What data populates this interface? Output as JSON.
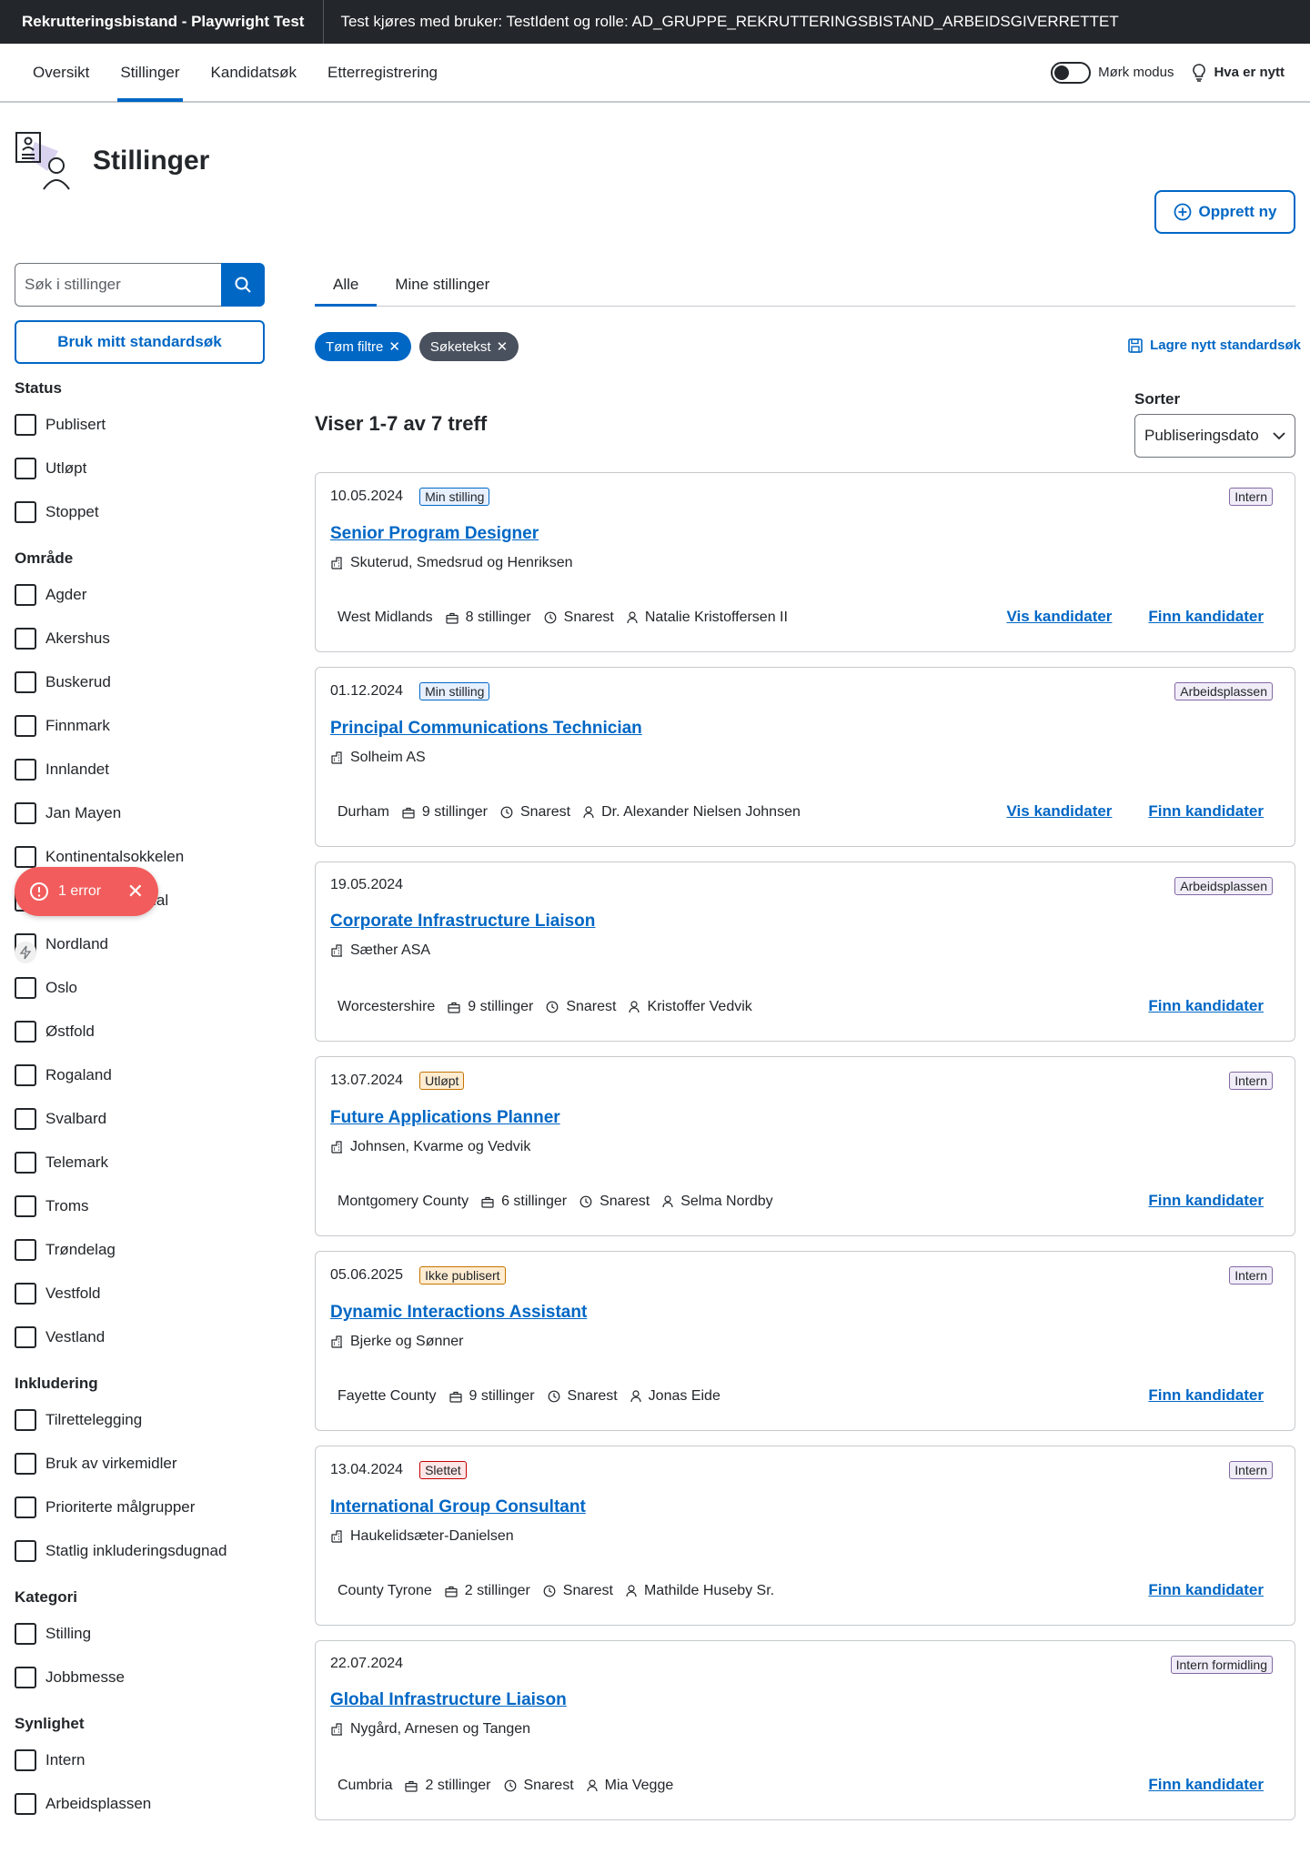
{
  "header": {
    "app_title": "Rekrutteringsbistand - Playwright Test",
    "test_info": "Test kjøres med bruker: TestIdent og rolle: AD_GRUPPE_REKRUTTERINGSBISTAND_ARBEIDSGIVERRETTET"
  },
  "nav": {
    "tabs": [
      {
        "label": "Oversikt",
        "active": false
      },
      {
        "label": "Stillinger",
        "active": true
      },
      {
        "label": "Kandidatsøk",
        "active": false
      },
      {
        "label": "Etterregistrering",
        "active": false
      }
    ],
    "dark_mode_label": "Mørk modus",
    "whats_new_label": "Hva er nytt"
  },
  "page": {
    "title": "Stillinger",
    "create_button": "Opprett ny"
  },
  "sidebar": {
    "search_placeholder": "Søk i stillinger",
    "standard_search_button": "Bruk mitt standardsøk",
    "groups": [
      {
        "title": "Status",
        "items": [
          "Publisert",
          "Utløpt",
          "Stoppet"
        ]
      },
      {
        "title": "Område",
        "items": [
          "Agder",
          "Akershus",
          "Buskerud",
          "Finnmark",
          "Innlandet",
          "Jan Mayen",
          "Kontinentalsokkelen",
          "Møre og Romsdal",
          "Nordland",
          "Oslo",
          "Østfold",
          "Rogaland",
          "Svalbard",
          "Telemark",
          "Troms",
          "Trøndelag",
          "Vestfold",
          "Vestland"
        ]
      },
      {
        "title": "Inkludering",
        "items": [
          "Tilrettelegging",
          "Bruk av virkemidler",
          "Prioriterte målgrupper",
          "Statlig inkluderingsdugnad"
        ]
      },
      {
        "title": "Kategori",
        "items": [
          "Stilling",
          "Jobbmesse"
        ]
      },
      {
        "title": "Synlighet",
        "items": [
          "Intern",
          "Arbeidsplassen"
        ]
      }
    ]
  },
  "toast": {
    "label": "1 error"
  },
  "main": {
    "tabs": [
      {
        "label": "Alle",
        "active": true
      },
      {
        "label": "Mine stillinger",
        "active": false
      }
    ],
    "chips": [
      {
        "label": "Tøm filtre",
        "style": "blue"
      },
      {
        "label": "Søketekst",
        "style": "dark"
      }
    ],
    "save_standard": "Lagre nytt standardsøk",
    "result_count": "Viser 1-7 av 7 treff",
    "sort_label": "Sorter",
    "sort_value": "Publiseringsdato"
  },
  "cards": [
    {
      "date": "10.05.2024",
      "status": "Min stilling",
      "status_color": "blue",
      "type": "Intern",
      "title": "Senior Program Designer",
      "employer": "Skuterud, Smedsrud og Henriksen",
      "location": "West Midlands",
      "positions": "8 stillinger",
      "deadline": "Snarest",
      "owner": "Natalie Kristoffersen II",
      "vis": "Vis kandidater",
      "finn": "Finn kandidater"
    },
    {
      "date": "01.12.2024",
      "status": "Min stilling",
      "status_color": "blue",
      "type": "Arbeidsplassen",
      "title": "Principal Communications Technician",
      "employer": "Solheim AS",
      "location": "Durham",
      "positions": "9 stillinger",
      "deadline": "Snarest",
      "owner": "Dr. Alexander Nielsen Johnsen",
      "vis": "Vis kandidater",
      "finn": "Finn kandidater"
    },
    {
      "date": "19.05.2024",
      "status": "",
      "status_color": "",
      "type": "Arbeidsplassen",
      "title": "Corporate Infrastructure Liaison",
      "employer": "Sæther ASA",
      "location": "Worcestershire",
      "positions": "9 stillinger",
      "deadline": "Snarest",
      "owner": "Kristoffer Vedvik",
      "vis": "",
      "finn": "Finn kandidater"
    },
    {
      "date": "13.07.2024",
      "status": "Utløpt",
      "status_color": "orange",
      "type": "Intern",
      "title": "Future Applications Planner",
      "employer": "Johnsen, Kvarme og Vedvik",
      "location": "Montgomery County",
      "positions": "6 stillinger",
      "deadline": "Snarest",
      "owner": "Selma Nordby",
      "vis": "",
      "finn": "Finn kandidater"
    },
    {
      "date": "05.06.2025",
      "status": "Ikke publisert",
      "status_color": "orange",
      "type": "Intern",
      "title": "Dynamic Interactions Assistant",
      "employer": "Bjerke og Sønner",
      "location": "Fayette County",
      "positions": "9 stillinger",
      "deadline": "Snarest",
      "owner": "Jonas Eide",
      "vis": "",
      "finn": "Finn kandidater"
    },
    {
      "date": "13.04.2024",
      "status": "Slettet",
      "status_color": "red",
      "type": "Intern",
      "title": "International Group Consultant",
      "employer": "Haukelidsæter-Danielsen",
      "location": "County Tyrone",
      "positions": "2 stillinger",
      "deadline": "Snarest",
      "owner": "Mathilde Huseby Sr.",
      "vis": "",
      "finn": "Finn kandidater"
    },
    {
      "date": "22.07.2024",
      "status": "",
      "status_color": "",
      "type": "Intern formidling",
      "title": "Global Infrastructure Liaison",
      "employer": "Nygård, Arnesen og Tangen",
      "location": "Cumbria",
      "positions": "2 stillinger",
      "deadline": "Snarest",
      "owner": "Mia Vegge",
      "vis": "",
      "finn": "Finn kandidater"
    }
  ]
}
